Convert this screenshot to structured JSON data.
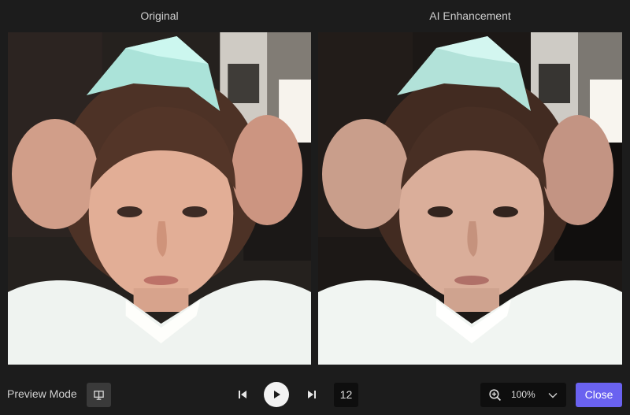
{
  "panels": {
    "left_title": "Original",
    "right_title": "AI Enhancement"
  },
  "toolbar": {
    "preview_mode_label": "Preview Mode",
    "frame_number": "12",
    "zoom_value": "100%",
    "close_label": "Close"
  },
  "icons": {
    "preview_toggle": "monitor-split-icon",
    "previous": "skip-previous-icon",
    "play": "play-icon",
    "next": "skip-next-icon",
    "zoom": "zoom-in-icon",
    "zoom_dropdown": "chevron-down-icon"
  },
  "colors": {
    "background": "#1c1c1c",
    "accent": "#6a62f0",
    "dark_box": "#0e0e0e"
  }
}
